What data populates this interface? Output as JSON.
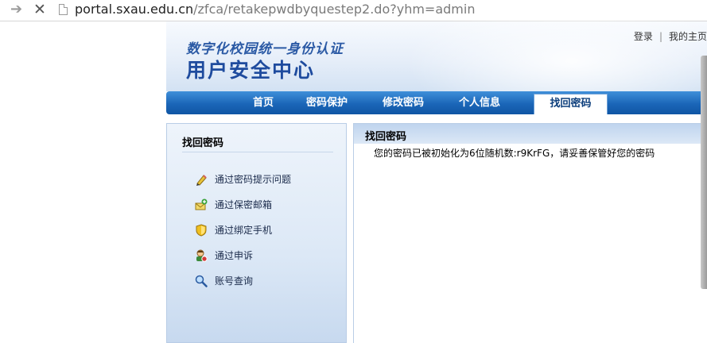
{
  "browser": {
    "url_host": "portal.sxau.edu.cn",
    "url_path": "/zfca/retakepwdbyquestep2.do?yhm=admin"
  },
  "header": {
    "subtitle": "数字化校园统一身份认证",
    "title": "用户安全中心",
    "links": [
      "登录",
      "我的主页"
    ]
  },
  "nav": {
    "items": [
      {
        "label": "首页",
        "active": false
      },
      {
        "label": "密码保护",
        "active": false
      },
      {
        "label": "修改密码",
        "active": false
      },
      {
        "label": "个人信息",
        "active": false
      },
      {
        "label": "找回密码",
        "active": true
      }
    ]
  },
  "sidebar": {
    "title": "找回密码",
    "items": [
      {
        "label": "通过密码提示问题",
        "icon": "pencil-icon"
      },
      {
        "label": "通过保密邮箱",
        "icon": "mail-add-icon"
      },
      {
        "label": "通过绑定手机",
        "icon": "shield-icon"
      },
      {
        "label": "通过申诉",
        "icon": "user-appeal-icon"
      },
      {
        "label": "账号查询",
        "icon": "magnifier-icon"
      }
    ]
  },
  "main": {
    "title": "找回密码",
    "message": "您的密码已被初始化为6位随机数:r9KrFG，请妥善保管好您的密码"
  },
  "colors": {
    "nav_blue": "#1b66b8",
    "title_blue": "#1e4b9e"
  }
}
